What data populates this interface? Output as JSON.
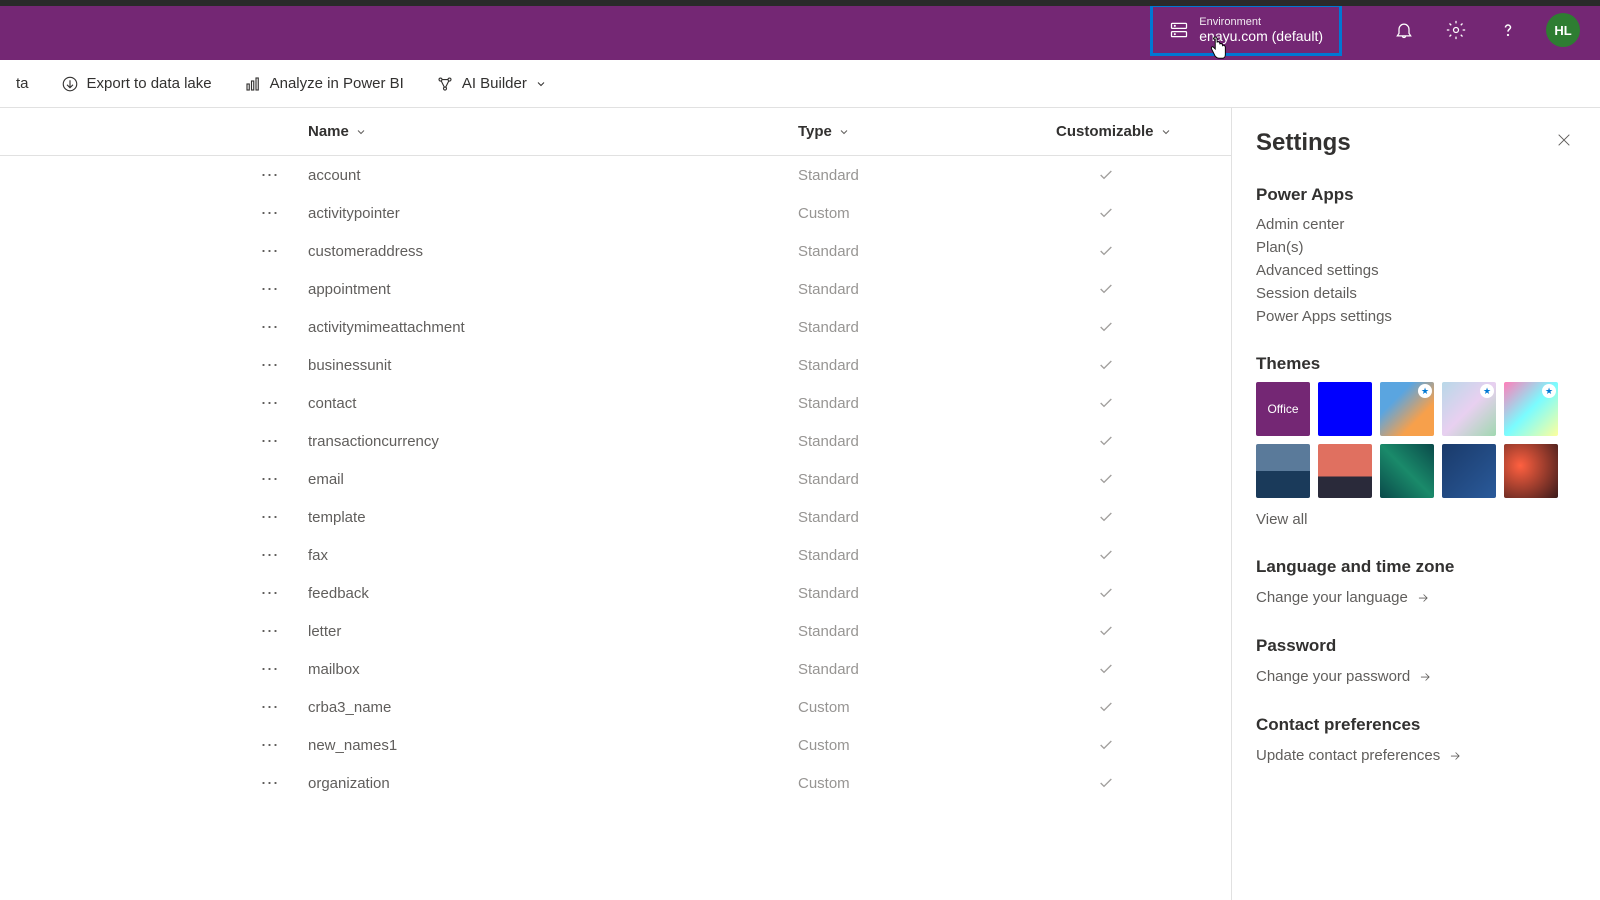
{
  "header": {
    "env_label": "Environment",
    "env_name": "enayu.com (default)",
    "avatar": "HL"
  },
  "commandbar": {
    "item0": "ta",
    "export_data_lake": "Export to data lake",
    "analyze_powerbi": "Analyze in Power BI",
    "ai_builder": "AI Builder"
  },
  "table": {
    "headers": {
      "name": "Name",
      "type": "Type",
      "customizable": "Customizable"
    },
    "rows": [
      {
        "name": "account",
        "type": "Standard",
        "customizable": true
      },
      {
        "name": "activitypointer",
        "type": "Custom",
        "customizable": true
      },
      {
        "name": "customeraddress",
        "type": "Standard",
        "customizable": true
      },
      {
        "name": "appointment",
        "type": "Standard",
        "customizable": true
      },
      {
        "name": "activitymimeattachment",
        "type": "Standard",
        "customizable": true
      },
      {
        "name": "businessunit",
        "type": "Standard",
        "customizable": true
      },
      {
        "name": "contact",
        "type": "Standard",
        "customizable": true
      },
      {
        "name": "transactioncurrency",
        "type": "Standard",
        "customizable": true
      },
      {
        "name": "email",
        "type": "Standard",
        "customizable": true
      },
      {
        "name": "template",
        "type": "Standard",
        "customizable": true
      },
      {
        "name": "fax",
        "type": "Standard",
        "customizable": true
      },
      {
        "name": "feedback",
        "type": "Standard",
        "customizable": true
      },
      {
        "name": "letter",
        "type": "Standard",
        "customizable": true
      },
      {
        "name": "mailbox",
        "type": "Standard",
        "customizable": true
      },
      {
        "name": "crba3_name",
        "type": "Custom",
        "customizable": true
      },
      {
        "name": "new_names1",
        "type": "Custom",
        "customizable": true
      },
      {
        "name": "organization",
        "type": "Custom",
        "customizable": true
      }
    ]
  },
  "settings": {
    "title": "Settings",
    "powerapps": {
      "title": "Power Apps",
      "links": [
        "Admin center",
        "Plan(s)",
        "Advanced settings",
        "Session details",
        "Power Apps settings"
      ]
    },
    "themes": {
      "title": "Themes",
      "office_label": "Office",
      "view_all": "View all"
    },
    "language": {
      "title": "Language and time zone",
      "action": "Change your language"
    },
    "password": {
      "title": "Password",
      "action": "Change your password"
    },
    "contact": {
      "title": "Contact preferences",
      "action": "Update contact preferences"
    }
  },
  "themes_colors": [
    "#742774",
    "#0000ff",
    "linear-gradient(135deg,#5aa5e0 30%,#f7a04b 70%)",
    "linear-gradient(135deg,#b8d8e8,#e8d0f0,#a0d8b0)",
    "linear-gradient(135deg,#ff7eb9,#7afcff,#feff9c)",
    "linear-gradient(180deg,#5a7a9a 50%,#1a3a5a 50%)",
    "linear-gradient(180deg,#e07060 60%,#2a2a3a 60%)",
    "linear-gradient(45deg,#0a4a4a,#1a8a6a,#0a4a4a)",
    "linear-gradient(135deg,#1a3a6a,#2a5a9a)",
    "radial-gradient(circle at 30% 40%,#ff6040,#3a1a1a)"
  ]
}
